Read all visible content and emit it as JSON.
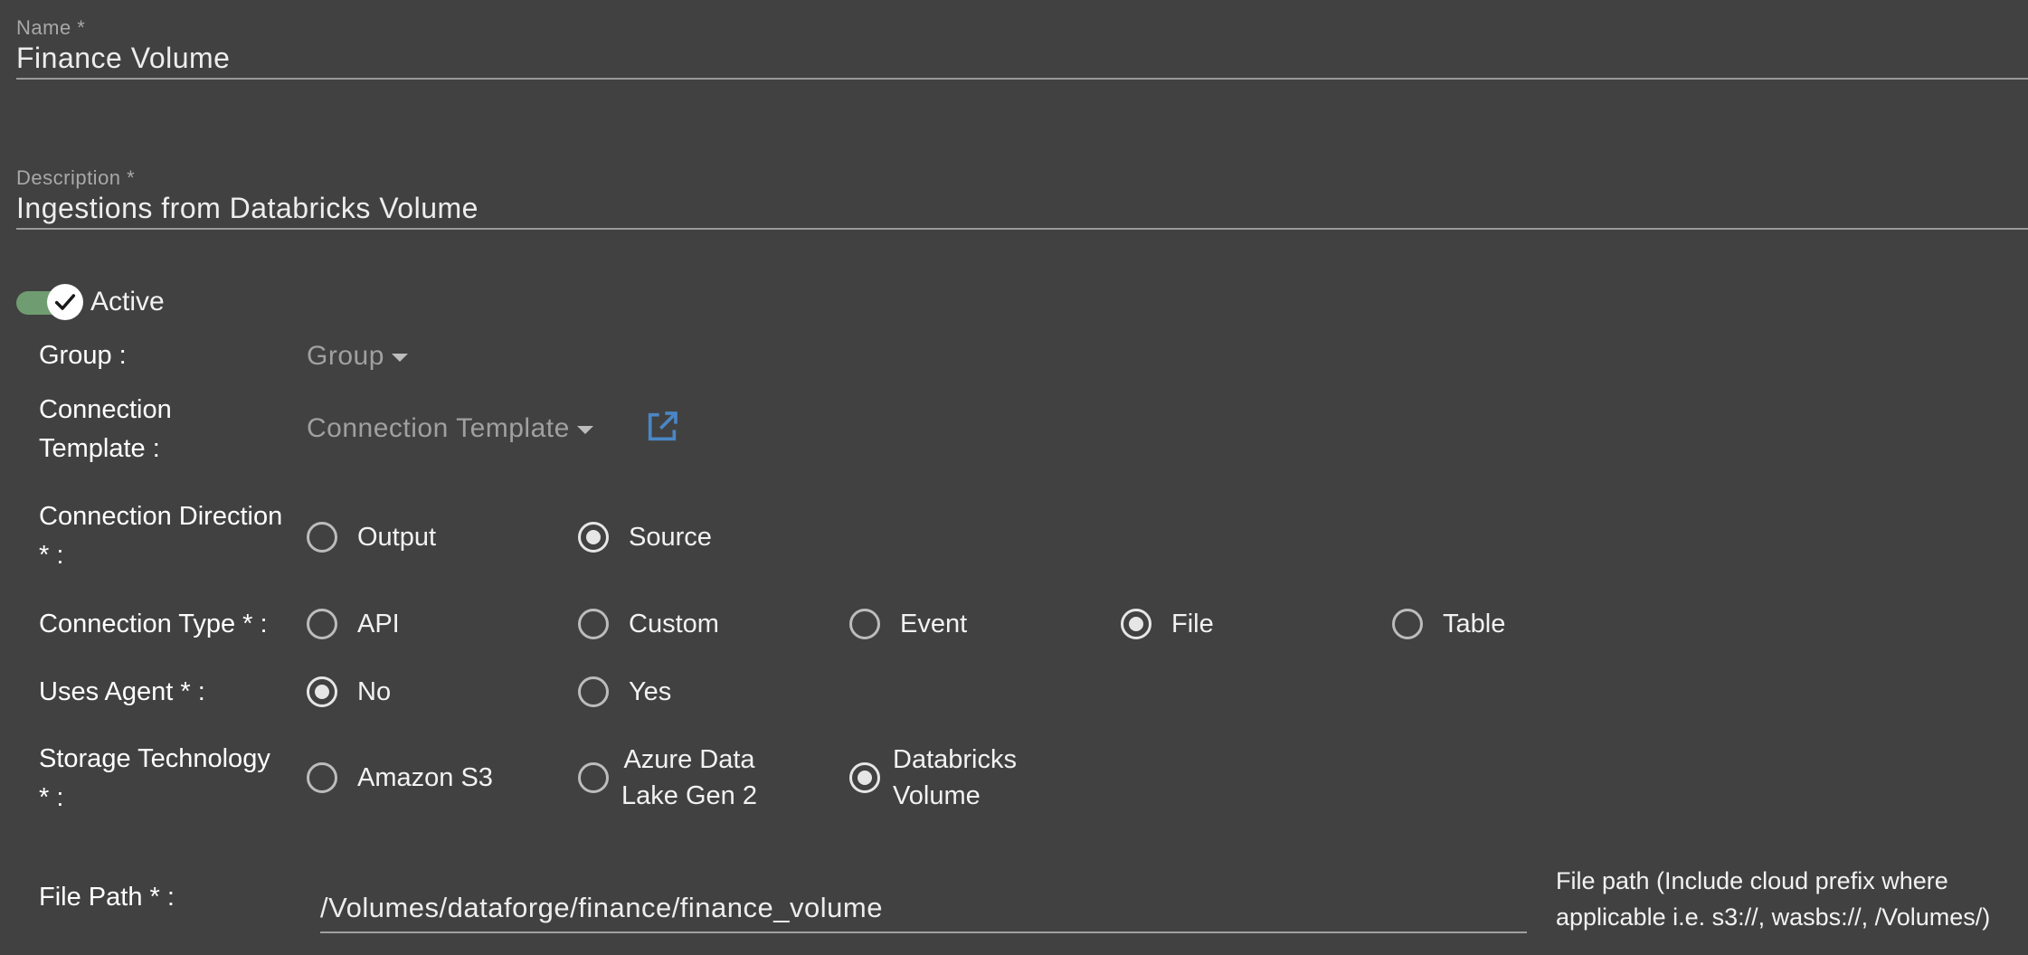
{
  "name_field": {
    "label": "Name *",
    "value": "Finance Volume"
  },
  "description_field": {
    "label": "Description *",
    "value": "Ingestions from Databricks Volume"
  },
  "active_toggle": {
    "label": "Active",
    "on": true
  },
  "group": {
    "label": "Group :",
    "placeholder": "Group"
  },
  "connection_template": {
    "label_line1": "Connection",
    "label_line2": "Template :",
    "placeholder": "Connection Template"
  },
  "connection_direction": {
    "label_line1": "Connection Direction",
    "label_line2": "* :",
    "options": [
      {
        "label": "Output",
        "checked": false
      },
      {
        "label": "Source",
        "checked": true
      }
    ]
  },
  "connection_type": {
    "label": "Connection Type * :",
    "options": [
      {
        "label": "API",
        "checked": false
      },
      {
        "label": "Custom",
        "checked": false
      },
      {
        "label": "Event",
        "checked": false
      },
      {
        "label": "File",
        "checked": true
      },
      {
        "label": "Table",
        "checked": false
      }
    ]
  },
  "uses_agent": {
    "label": "Uses Agent * :",
    "options": [
      {
        "label": "No",
        "checked": true
      },
      {
        "label": "Yes",
        "checked": false
      }
    ]
  },
  "storage_technology": {
    "label_line1": "Storage Technology",
    "label_line2": "* :",
    "options": [
      {
        "label": "Amazon S3",
        "checked": false
      },
      {
        "label_line1": "Azure Data",
        "label_line2": "Lake Gen 2",
        "checked": false
      },
      {
        "label_line1": "Databricks",
        "label_line2": "Volume",
        "checked": true
      }
    ]
  },
  "file_path": {
    "label": "File Path * :",
    "value": "/Volumes/dataforge/finance/finance_volume",
    "helper_line1": "File path (Include cloud prefix where",
    "helper_line2": "applicable i.e. s3://, wasbs://, /Volumes/)"
  },
  "colors": {
    "background": "#414141",
    "toggle_track": "#6f9c70",
    "link_icon": "#4a86c5"
  },
  "icons": {
    "toggle_check": "check-icon",
    "template_link": "open-in-new-icon",
    "dropdown": "caret-down-icon"
  }
}
